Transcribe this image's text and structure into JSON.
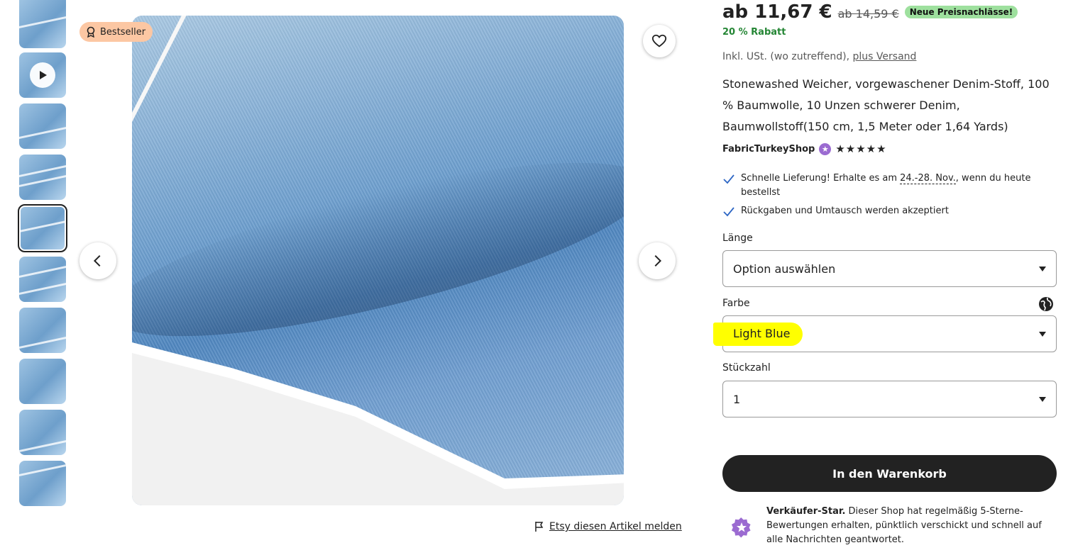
{
  "colors": {
    "accent": "#222222",
    "discount": "#258635",
    "badge_new": "#9ee09e",
    "bestseller_badge": "#fcc7a3",
    "star_seller": "#9b6bd1",
    "highlight": "#ffff00"
  },
  "gallery": {
    "bestseller_label": "Bestseller",
    "thumbnail_count": 10,
    "selected_thumbnail": 5
  },
  "report_link": "Etsy diesen Artikel melden",
  "product": {
    "price": "ab 11,67 €",
    "old_price": "ab 14,59 €",
    "price_badge": "Neue Preisnachlässe!",
    "discount": "20 % Rabatt",
    "tax_text": "Inkl. USt. (wo zutreffend),",
    "shipping_link": "plus Versand",
    "title": "Stonewashed Weicher, vorgewaschener Denim-Stoff, 100 % Baumwolle, 10 Unzen schwerer Denim, Baumwollstoff(150 cm, 1,5 Meter oder 1,64 Yards)",
    "shop_name": "FabricTurkeyShop",
    "rating_stars": "★★★★★"
  },
  "bullets": {
    "delivery_prefix": "Schnelle Lieferung! Erhalte es am",
    "delivery_dates": "24.-28. Nov.",
    "delivery_suffix": ", wenn du heute bestellst",
    "returns": "Rückgaben und Umtausch werden akzeptiert"
  },
  "options": {
    "length_label": "Länge",
    "length_value": "Option auswählen",
    "color_label": "Farbe",
    "color_value": "Light Blue",
    "qty_label": "Stückzahl",
    "qty_value": "1"
  },
  "cart_button": "In den Warenkorb",
  "star_seller": {
    "title": "Verkäufer-Star.",
    "text": "Dieser Shop hat regelmäßig 5-Sterne-Bewertungen erhalten, pünktlich verschickt und schnell auf alle Nachrichten geantwortet."
  }
}
